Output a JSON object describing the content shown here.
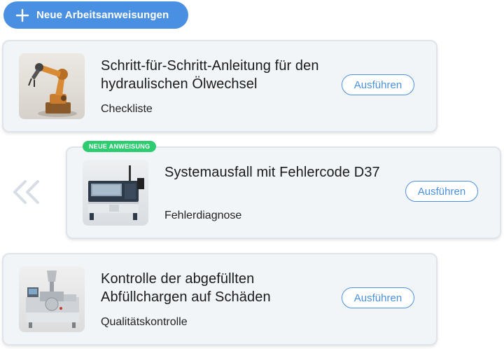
{
  "header": {
    "new_button_label": "Neue Arbeitsanweisungen"
  },
  "cards": [
    {
      "title": "Schritt-für-Schritt-Anleitung für den hydraulischen Ölwechsel",
      "type": "Checkliste",
      "run_label": "Ausführen",
      "thumbnail_icon": "robot-arm-image"
    },
    {
      "badge": "NEUE ANWEISUNG",
      "title": "Systemausfall mit Fehlercode D37",
      "type": "Fehlerdiagnose",
      "run_label": "Ausführen",
      "thumbnail_icon": "laser-machine-image"
    },
    {
      "title": "Kontrolle der abgefüllten Abfüllchargen auf Schäden",
      "type": "Qualitätskontrolle",
      "run_label": "Ausführen",
      "thumbnail_icon": "filling-machine-image"
    }
  ],
  "colors": {
    "accent": "#4a90e2",
    "badge": "#2ecc71",
    "card_bg": "#f2f5f8"
  }
}
